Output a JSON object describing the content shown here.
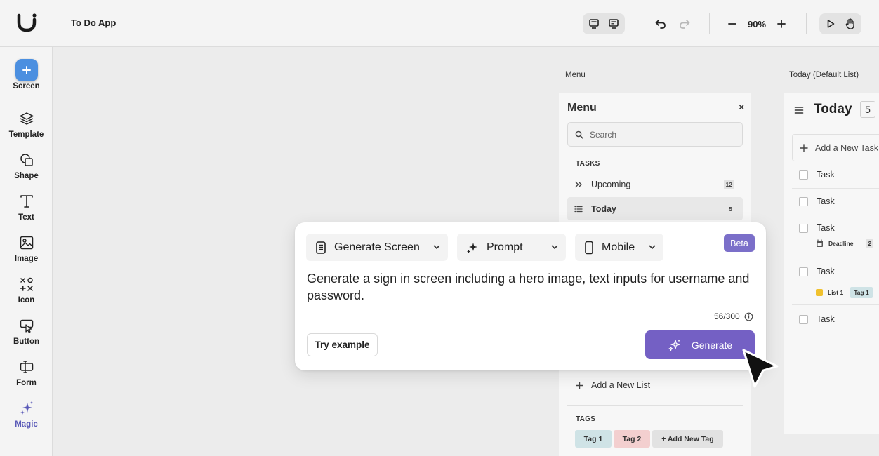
{
  "app": {
    "title": "To Do App"
  },
  "toolbar": {
    "zoom": "90%"
  },
  "rail": {
    "tools": [
      {
        "label": "Screen",
        "icon": "plus-icon"
      },
      {
        "label": "Template",
        "icon": "layers-icon"
      },
      {
        "label": "Shape",
        "icon": "shapes-icon"
      },
      {
        "label": "Text",
        "icon": "text-icon"
      },
      {
        "label": "Image",
        "icon": "image-icon"
      },
      {
        "label": "Icon",
        "icon": "icon-set-icon"
      },
      {
        "label": "Button",
        "icon": "button-icon"
      },
      {
        "label": "Form",
        "icon": "form-icon"
      },
      {
        "label": "Magic",
        "icon": "sparkle-icon"
      }
    ]
  },
  "canvas": {
    "menu_frame_label": "Menu",
    "today_frame_label": "Today (Default List)"
  },
  "menu": {
    "title": "Menu",
    "close": "×",
    "search_placeholder": "Search",
    "tasks_heading": "TASKS",
    "items": [
      {
        "label": "Upcoming",
        "count": "12"
      },
      {
        "label": "Today",
        "count": "5"
      }
    ],
    "add_list": "Add a New List",
    "tags_heading": "TAGS",
    "tags": [
      "Tag 1",
      "Tag 2",
      "+ Add New Tag"
    ]
  },
  "today": {
    "title": "Today",
    "count": "5",
    "add_task": "Add a New Task",
    "tasks": [
      "Task",
      "Task",
      "Task",
      "Task",
      "Task"
    ],
    "deadline_label": "Deadline",
    "deadline_count": "2",
    "list_label": "List 1",
    "tag_label": "Tag 1"
  },
  "generator": {
    "mode": "Generate Screen",
    "input_type": "Prompt",
    "device": "Mobile",
    "badge": "Beta",
    "prompt": "Generate a sign in screen including a hero image, text inputs for username and password.",
    "char_count": "56/300",
    "try_example": "Try example",
    "generate": "Generate"
  },
  "colors": {
    "accent_blue": "#4b8fe0",
    "generate_purple": "#7460c4",
    "beta_purple": "#7b6fc9",
    "tag1": "#cfe3e6",
    "tag2": "#f3cfcf",
    "list_yellow": "#f0c12e"
  }
}
